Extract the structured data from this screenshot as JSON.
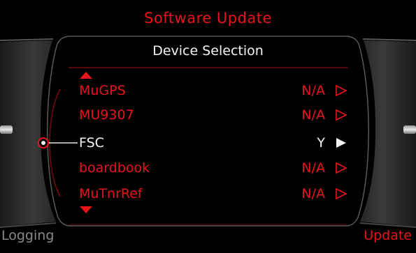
{
  "header": {
    "title": "Software Update",
    "subtitle": "Device Selection"
  },
  "devices": [
    {
      "name": "MuGPS",
      "status": "N/A",
      "selected": false
    },
    {
      "name": "MU9307",
      "status": "N/A",
      "selected": false
    },
    {
      "name": "FSC",
      "status": "Y",
      "selected": true
    },
    {
      "name": "boardbook",
      "status": "N/A",
      "selected": false
    },
    {
      "name": "MuTnrRef",
      "status": "N/A",
      "selected": false
    }
  ],
  "softkeys": {
    "left": "Logging",
    "right": "Update"
  },
  "colors": {
    "accent": "#e8141c",
    "text": "#f4f4f4",
    "inactive": "#8a8a8a",
    "background": "#000000"
  },
  "icons": {
    "row_arrow": "triangle-right-outline-icon",
    "selected_arrow": "triangle-right-filled-icon",
    "scroll_up": "triangle-up-icon",
    "scroll_down": "triangle-down-icon",
    "rotary": "rotary-knob-indicator-icon"
  }
}
